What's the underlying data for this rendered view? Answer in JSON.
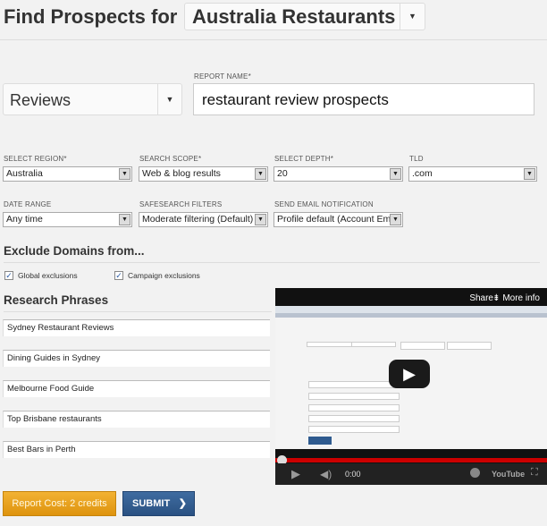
{
  "header": {
    "title": "Find Prospects for",
    "campaign": "Australia Restaurants"
  },
  "report_type": {
    "value": "Reviews"
  },
  "report_name": {
    "label": "REPORT NAME*",
    "value": "restaurant review prospects"
  },
  "fields": [
    {
      "label": "SELECT REGION*",
      "value": "Australia"
    },
    {
      "label": "SEARCH SCOPE*",
      "value": "Web & blog results"
    },
    {
      "label": "SELECT DEPTH*",
      "value": "20"
    },
    {
      "label": "TLD",
      "value": ".com"
    },
    {
      "label": "DATE RANGE",
      "value": "Any time"
    },
    {
      "label": "SAFESEARCH FILTERS",
      "value": "Moderate filtering (Default)"
    },
    {
      "label": "SEND EMAIL NOTIFICATION",
      "value": "Profile default (Account Email"
    }
  ],
  "exclude": {
    "title": "Exclude Domains from...",
    "options": [
      {
        "label": "Global exclusions",
        "checked": true
      },
      {
        "label": "Campaign exclusions",
        "checked": true
      }
    ]
  },
  "phrases": {
    "title": "Research Phrases",
    "items": [
      "Sydney Restaurant Reviews",
      "Dining Guides in Sydney",
      "Melbourne Food Guide",
      "Top Brisbane restaurants",
      "Best Bars in Perth"
    ]
  },
  "video": {
    "share": "Share",
    "more_info": "More info",
    "time": "0:00",
    "progress": 0,
    "brand": "YouTube"
  },
  "buttons": {
    "cost": "Report Cost: 2 credits",
    "submit": "SUBMIT"
  },
  "colors": {
    "cost": "#e9a020",
    "submit": "#2f5b8f",
    "video_progress": "#cc0000"
  }
}
